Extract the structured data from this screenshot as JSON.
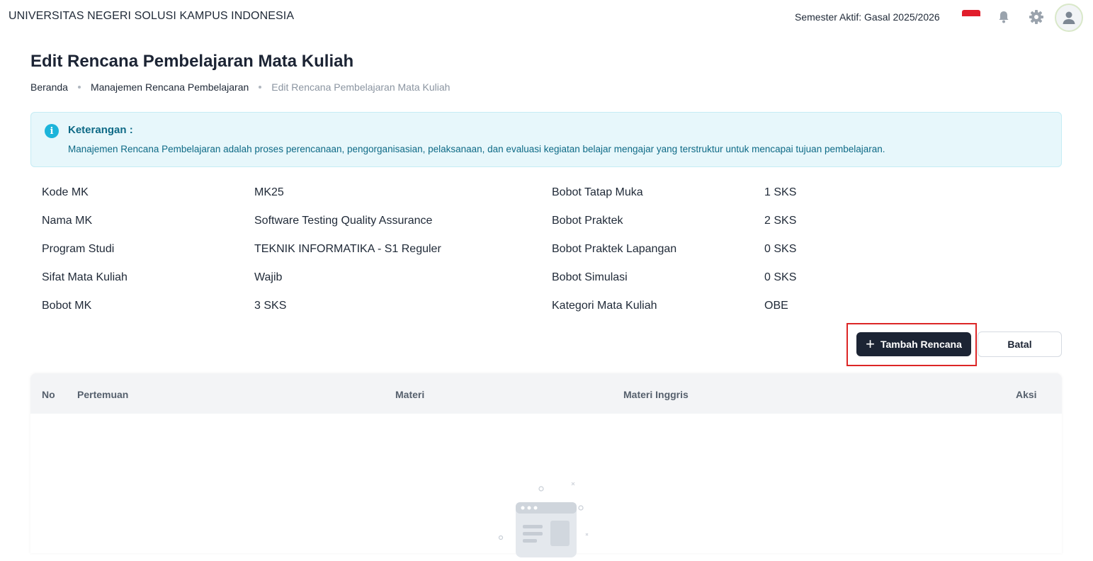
{
  "header": {
    "university": "UNIVERSITAS NEGERI SOLUSI KAMPUS INDONESIA",
    "semester": "Semester Aktif: Gasal 2025/2026",
    "icons": [
      "flag-indonesia-icon",
      "bell-icon",
      "gear-icon",
      "user-avatar-icon"
    ]
  },
  "page": {
    "title": "Edit Rencana Pembelajaran Mata Kuliah",
    "breadcrumb": [
      "Beranda",
      "Manajemen Rencana Pembelajaran",
      "Edit Rencana Pembelajaran Mata Kuliah"
    ]
  },
  "info": {
    "title": "Keterangan :",
    "text": "Manajemen Rencana Pembelajaran adalah proses perencanaan, pengorganisasian, pelaksanaan, dan evaluasi kegiatan belajar mengajar yang terstruktur untuk mencapai tujuan pembelajaran."
  },
  "details_left": [
    {
      "label": "Kode MK",
      "value": "MK25"
    },
    {
      "label": "Nama MK",
      "value": "Software Testing Quality Assurance"
    },
    {
      "label": "Program Studi",
      "value": "TEKNIK INFORMATIKA - S1 Reguler"
    },
    {
      "label": "Sifat Mata Kuliah",
      "value": "Wajib"
    },
    {
      "label": "Bobot MK",
      "value": "3 SKS"
    }
  ],
  "details_right": [
    {
      "label": "Bobot Tatap Muka",
      "value": "1 SKS"
    },
    {
      "label": "Bobot Praktek",
      "value": "2 SKS"
    },
    {
      "label": "Bobot Praktek Lapangan",
      "value": "0 SKS"
    },
    {
      "label": "Bobot Simulasi",
      "value": "0 SKS"
    },
    {
      "label": "Kategori Mata Kuliah",
      "value": "OBE"
    }
  ],
  "actions": {
    "add_label": "Tambah Rencana",
    "cancel_label": "Batal"
  },
  "table": {
    "columns": [
      "No",
      "Pertemuan",
      "Materi",
      "Materi Inggris",
      "Aksi"
    ],
    "rows": []
  },
  "colors": {
    "primary": "#1c2434",
    "info_bg": "#e7f7fb",
    "info_text": "#0e6a86",
    "highlight": "#dc2626",
    "flag_red": "#e11d2b"
  }
}
